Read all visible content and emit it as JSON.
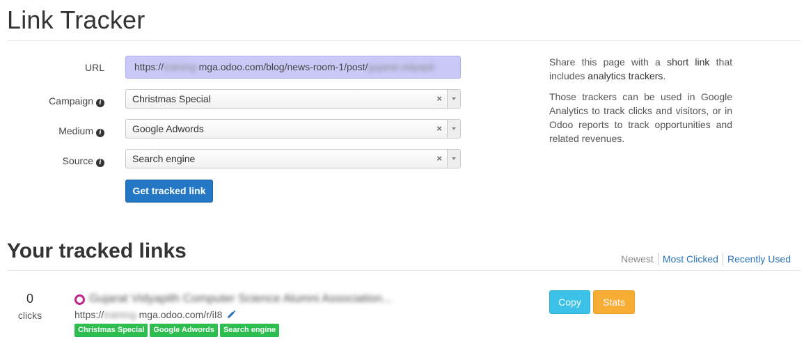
{
  "page": {
    "title": "Link Tracker"
  },
  "form": {
    "url": {
      "label": "URL",
      "value_prefix": "https://",
      "value_blur_1": "training-",
      "value_middle": "mga.odoo.com/blog/news-room-1/post/",
      "value_blur_2": "gujarat-vidyapit"
    },
    "campaign": {
      "label": "Campaign",
      "value": "Christmas Special",
      "clear": "×"
    },
    "medium": {
      "label": "Medium",
      "value": "Google Adwords",
      "clear": "×"
    },
    "source": {
      "label": "Source",
      "value": "Search engine",
      "clear": "×"
    },
    "submit_label": "Get tracked link"
  },
  "info": {
    "p1_a": "Share this page with a ",
    "p1_b": "short link",
    "p1_c": " that includes ",
    "p1_d": "analytics trackers",
    "p1_e": ".",
    "p2": "Those trackers can be used in Google Analytics to track clicks and visitors, or in Odoo reports to track opportunities and related revenues."
  },
  "tracked": {
    "title": "Your tracked links",
    "sort": {
      "newest": "Newest",
      "most_clicked": "Most Clicked",
      "recently_used": "Recently Used"
    },
    "links": [
      {
        "clicks": "0",
        "clicks_label": "clicks",
        "title": "Gujarat Vidyapith Computer Science Alumni Association...",
        "short_url_prefix": "https://",
        "short_url_blur": "training-",
        "short_url_suffix": "mga.odoo.com/r/iI8",
        "tags": [
          "Christmas Special",
          "Google Adwords",
          "Search engine"
        ],
        "copy_label": "Copy",
        "stats_label": "Stats"
      }
    ]
  },
  "colors": {
    "primary": "#2377c4",
    "url_highlight": "#c9c8f7",
    "tag_green": "#2ebd4f",
    "copy_cyan": "#3cc2e8",
    "stats_orange": "#f7ad34",
    "circle_magenta": "#c2258a"
  },
  "icons": {
    "info": "info-circle-icon",
    "pencil": "pencil-icon",
    "circle": "circle-icon",
    "dropdown": "chevron-down-icon"
  }
}
